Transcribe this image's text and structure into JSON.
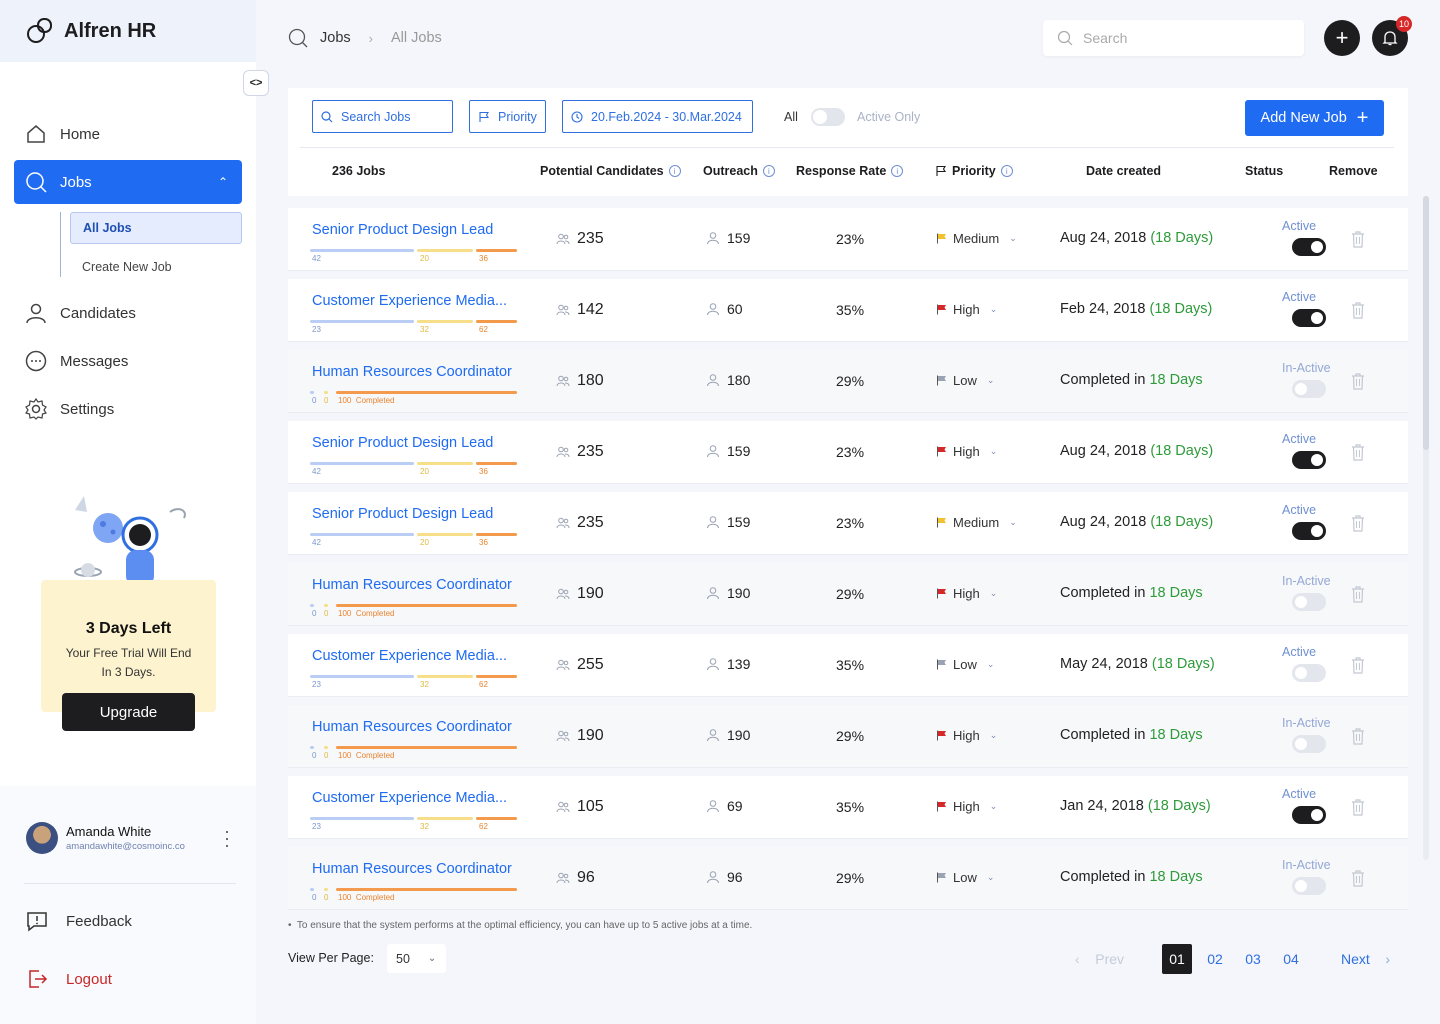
{
  "app": {
    "brand": "Alfren HR"
  },
  "sidebar": {
    "nav": [
      {
        "label": "Home",
        "icon": "home-icon"
      },
      {
        "label": "Jobs",
        "icon": "search-icon"
      },
      {
        "label": "Candidates",
        "icon": "user-icon"
      },
      {
        "label": "Messages",
        "icon": "chat-icon"
      },
      {
        "label": "Settings",
        "icon": "gear-icon"
      }
    ],
    "sub": [
      {
        "label": "All Jobs"
      },
      {
        "label": "Create New Job"
      }
    ],
    "trial": {
      "title": "3 Days Left",
      "text1": "Your Free Trial Will End",
      "text2": "In 3 Days.",
      "button": "Upgrade"
    },
    "user": {
      "name": "Amanda White",
      "email": "amandawhite@cosmoinc.co"
    },
    "footer": {
      "feedback": "Feedback",
      "logout": "Logout"
    }
  },
  "header": {
    "crumb1": "Jobs",
    "crumb2": "All Jobs",
    "search_placeholder": "Search",
    "notif_count": "10"
  },
  "toolbar": {
    "search_jobs": "Search Jobs",
    "priority": "Priority",
    "date_range": "20.Feb.2024 - 30.Mar.2024",
    "all": "All",
    "active_only": "Active Only",
    "add_job": "Add New Job"
  },
  "table": {
    "headers": {
      "jobs": "236 Jobs",
      "candidates": "Potential Candidates",
      "outreach": "Outreach",
      "response": "Response Rate",
      "priority": "Priority",
      "date": "Date created",
      "status": "Status",
      "remove": "Remove"
    },
    "rows": [
      {
        "title": "Senior Product Design Lead",
        "bar_type": "active",
        "b1": "42",
        "b2": "20",
        "b3": "36",
        "candidates": "235",
        "outreach": "159",
        "response": "23%",
        "priority": "Medium",
        "date_prefix": "Aug 24, 2018",
        "date_suffix": "(18 Days)",
        "status": "Active",
        "on": true
      },
      {
        "title": "Customer Experience Media...",
        "bar_type": "active",
        "b1": "23",
        "b2": "32",
        "b3": "62",
        "candidates": "142",
        "outreach": "60",
        "response": "35%",
        "priority": "High",
        "date_prefix": "Feb 24, 2018",
        "date_suffix": "(18 Days)",
        "status": "Active",
        "on": true
      },
      {
        "title": "Human Resources Coordinator",
        "bar_type": "done",
        "b1": "0",
        "b2": "0",
        "b3": "100",
        "b3_label": "Completed",
        "candidates": "180",
        "outreach": "180",
        "response": "29%",
        "priority": "Low",
        "date_prefix": "Completed in",
        "date_suffix": "18 Days",
        "status": "In-Active",
        "on": false
      },
      {
        "title": "Senior Product Design Lead",
        "bar_type": "active",
        "b1": "42",
        "b2": "20",
        "b3": "36",
        "candidates": "235",
        "outreach": "159",
        "response": "23%",
        "priority": "High",
        "date_prefix": "Aug 24, 2018",
        "date_suffix": "(18 Days)",
        "status": "Active",
        "on": true
      },
      {
        "title": "Senior Product Design Lead",
        "bar_type": "active",
        "b1": "42",
        "b2": "20",
        "b3": "36",
        "candidates": "235",
        "outreach": "159",
        "response": "23%",
        "priority": "Medium",
        "date_prefix": "Aug 24, 2018",
        "date_suffix": "(18 Days)",
        "status": "Active",
        "on": true
      },
      {
        "title": "Human Resources Coordinator",
        "bar_type": "done",
        "b1": "0",
        "b2": "0",
        "b3": "100",
        "b3_label": "Completed",
        "candidates": "190",
        "outreach": "190",
        "response": "29%",
        "priority": "High",
        "date_prefix": "Completed in",
        "date_suffix": "18 Days",
        "status": "In-Active",
        "on": false
      },
      {
        "title": "Customer Experience Media...",
        "bar_type": "active",
        "b1": "23",
        "b2": "32",
        "b3": "62",
        "candidates": "255",
        "outreach": "139",
        "response": "35%",
        "priority": "Low",
        "date_prefix": "May 24, 2018",
        "date_suffix": "(18 Days)",
        "status": "Active",
        "on": false
      },
      {
        "title": "Human Resources Coordinator",
        "bar_type": "done",
        "b1": "0",
        "b2": "0",
        "b3": "100",
        "b3_label": "Completed",
        "candidates": "190",
        "outreach": "190",
        "response": "29%",
        "priority": "High",
        "date_prefix": "Completed in",
        "date_suffix": "18 Days",
        "status": "In-Active",
        "on": false
      },
      {
        "title": "Customer Experience Media...",
        "bar_type": "active",
        "b1": "23",
        "b2": "32",
        "b3": "62",
        "candidates": "105",
        "outreach": "69",
        "response": "35%",
        "priority": "High",
        "date_prefix": "Jan 24, 2018",
        "date_suffix": "(18 Days)",
        "status": "Active",
        "on": true
      },
      {
        "title": "Human Resources Coordinator",
        "bar_type": "done",
        "b1": "0",
        "b2": "0",
        "b3": "100",
        "b3_label": "Completed",
        "candidates": "96",
        "outreach": "96",
        "response": "29%",
        "priority": "Low",
        "date_prefix": "Completed in",
        "date_suffix": "18 Days",
        "status": "In-Active",
        "on": false
      }
    ]
  },
  "footer": {
    "note": "To ensure that the system performs at the optimal efficiency, you can have up to 5 active jobs at a time.",
    "view_per_page": "View Per Page:",
    "per_page_value": "50",
    "prev": "Prev",
    "next": "Next",
    "pages": [
      "01",
      "02",
      "03",
      "04"
    ]
  },
  "colors": {
    "accent": "#1f6bf2",
    "dark": "#1d1d1f",
    "high": "#d62828",
    "medium": "#f2c12e",
    "low": "#9aa3b2",
    "green": "#2e9b3a"
  }
}
